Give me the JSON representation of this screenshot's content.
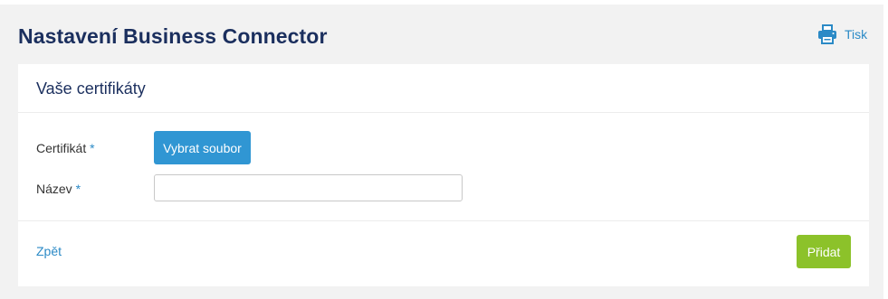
{
  "header": {
    "title": "Nastavení Business Connector",
    "print_label": "Tisk"
  },
  "icons": {
    "print": "printer-icon"
  },
  "colors": {
    "title": "#1b2f5e",
    "link": "#2b8ac6",
    "primary_button": "#3096d3",
    "success_button": "#8cc22a",
    "background": "#f2f2f2"
  },
  "card": {
    "title": "Vaše certifikáty",
    "fields": {
      "certificate": {
        "label": "Certifikát",
        "required_mark": "*",
        "button_label": "Vybrat soubor"
      },
      "name": {
        "label": "Název",
        "required_mark": "*",
        "value": ""
      }
    },
    "footer": {
      "back_label": "Zpět",
      "add_label": "Přidat"
    }
  }
}
